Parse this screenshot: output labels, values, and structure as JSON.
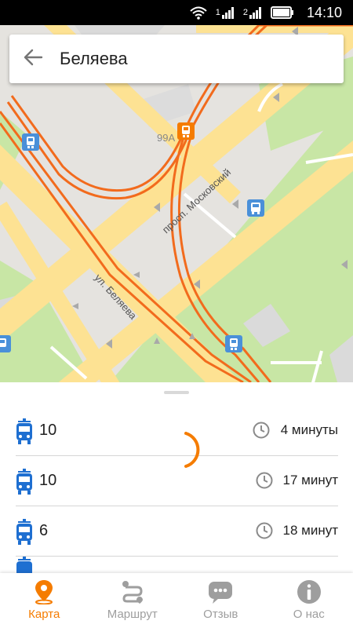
{
  "status_bar": {
    "time": "14:10",
    "network_labels": [
      "1",
      "2"
    ]
  },
  "search": {
    "query": "Беляева"
  },
  "map": {
    "street_labels": [
      "просп. Московский",
      "ул. Беляева"
    ],
    "building_number": "99А"
  },
  "arrivals": [
    {
      "vehicle": "tram-icon",
      "route": "10",
      "eta": "4 минуты"
    },
    {
      "vehicle": "tram-icon",
      "route": "10",
      "eta": "17 минут"
    },
    {
      "vehicle": "tram-icon",
      "route": "6",
      "eta": "18 минут"
    }
  ],
  "bottom_nav": [
    {
      "label": "Карта",
      "icon": "map-pin-icon",
      "active": true
    },
    {
      "label": "Маршрут",
      "icon": "route-icon",
      "active": false
    },
    {
      "label": "Отзыв",
      "icon": "chat-bubble-icon",
      "active": false
    },
    {
      "label": "О нас",
      "icon": "info-icon",
      "active": false
    }
  ],
  "colors": {
    "accent": "#f57c00",
    "route_line": "#f26b1d",
    "road": "#fde293",
    "park": "#c8e6a5",
    "tram_stop": "#4a90d9",
    "inactive": "#9e9e9e"
  }
}
